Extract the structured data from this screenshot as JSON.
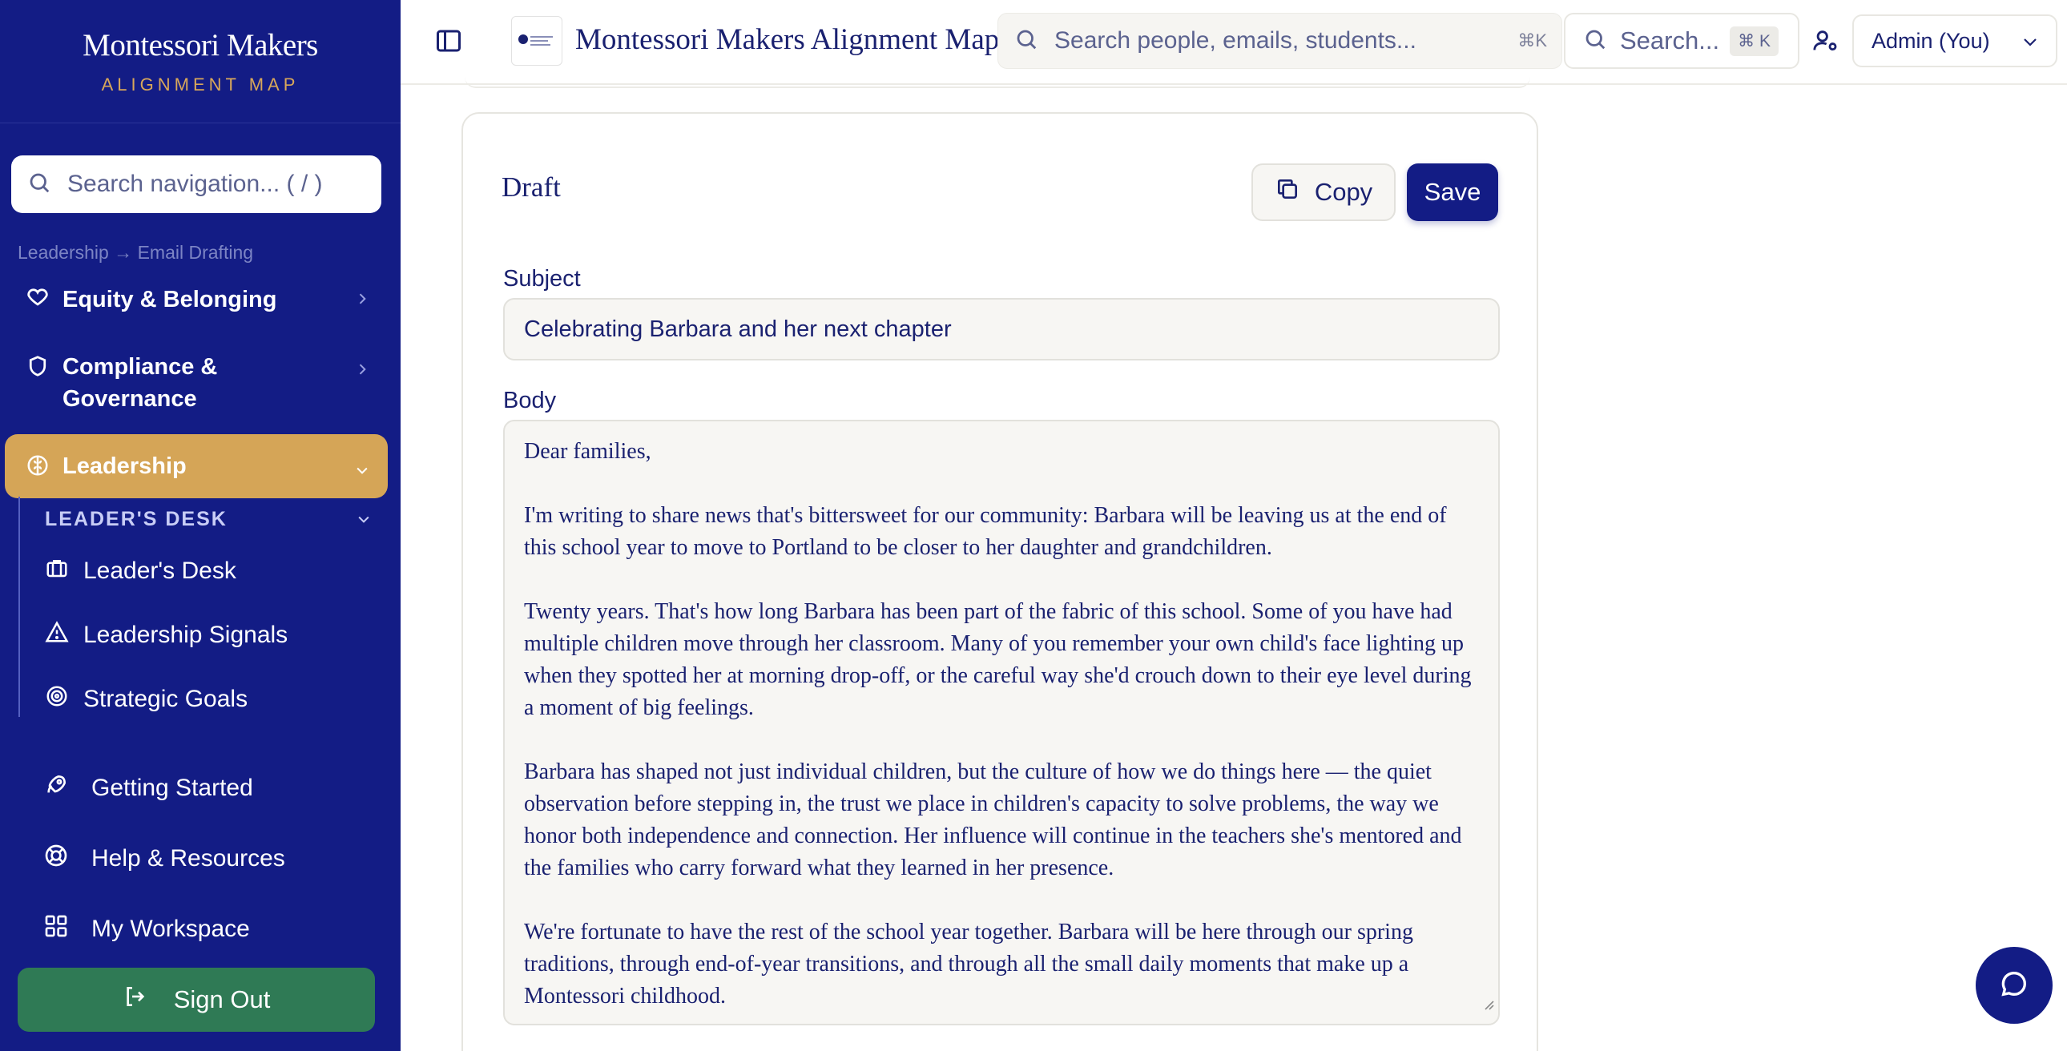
{
  "brand": {
    "title": "Montessori Makers",
    "subtitle": "ALIGNMENT MAP"
  },
  "nav_search": {
    "placeholder": "Search navigation... ( / )"
  },
  "breadcrumb": "Leadership → Email Drafting",
  "nav": {
    "equity": "Equity & Belonging",
    "compliance_line1": "Compliance &",
    "compliance_line2": "Governance",
    "leadership": "Leadership",
    "section": "LEADER'S DESK",
    "sub_items": [
      "Leader's Desk",
      "Leadership Signals",
      "Strategic Goals"
    ],
    "bottom_items": [
      "Getting Started",
      "Help & Resources",
      "My Workspace"
    ],
    "sign_out": "Sign Out"
  },
  "topbar": {
    "app_title": "Montessori Makers Alignment Map",
    "global_search_placeholder": "Search people, emails, students...",
    "global_search_shortcut": "⌘K",
    "quick_search_label": "Search...",
    "quick_search_shortcut": "⌘ K",
    "user": "Admin (You)"
  },
  "draft": {
    "title": "Draft",
    "copy_label": "Copy",
    "save_label": "Save",
    "subject_label": "Subject",
    "subject_value": "Celebrating Barbara and her next chapter",
    "body_label": "Body",
    "body_paragraphs": [
      "Dear families,",
      "I'm writing to share news that's bittersweet for our community: Barbara will be leaving us at the end of this school year to move to Portland to be closer to her daughter and grandchildren.",
      "Twenty years. That's how long Barbara has been part of the fabric of this school. Some of you have had multiple children move through her classroom. Many of you remember your own child's face lighting up when they spotted her at morning drop-off, or the careful way she'd crouch down to their eye level during a moment of big feelings.",
      "Barbara has shaped not just individual children, but the culture of how we do things here — the quiet observation before stepping in, the trust we place in children's capacity to solve problems, the way we honor both independence and connection. Her influence will continue in the teachers she's mentored and the families who carry forward what they learned in her presence.",
      "We're fortunate to have the rest of the school year together. Barbara will be here through our spring traditions, through end-of-year transitions, and through all the small daily moments that make up a Montessori childhood."
    ]
  },
  "colors": {
    "sidebar": "#131c85",
    "accent_gold": "#d5a557",
    "sign_out_green": "#2f7a55",
    "text_navy": "#1a2170"
  }
}
